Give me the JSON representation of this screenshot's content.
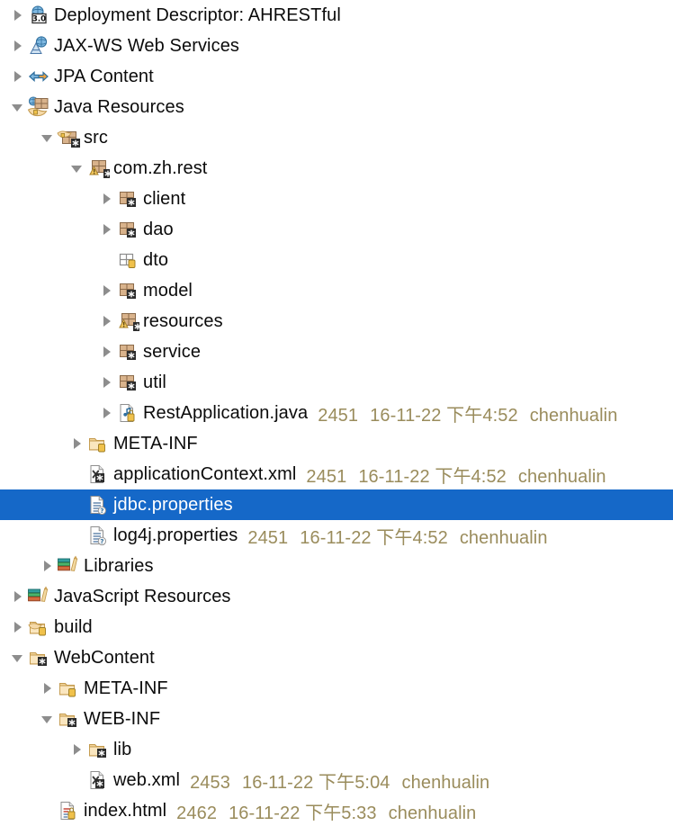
{
  "view": {
    "name": "project-explorer-tree",
    "selection_color": "#1568c8",
    "metadata_color": "#9a8c5c",
    "label_color": "#0b0b0b"
  },
  "rows": [
    {
      "label": "Deployment Descriptor: AHRESTful",
      "icon": "deployment-descriptor-icon",
      "depth": 0,
      "twisty": "collapsed",
      "selected": false,
      "meta": []
    },
    {
      "label": "JAX-WS Web Services",
      "icon": "jaxws-web-services-icon",
      "depth": 0,
      "twisty": "collapsed",
      "selected": false,
      "meta": []
    },
    {
      "label": "JPA Content",
      "icon": "jpa-content-icon",
      "depth": 0,
      "twisty": "collapsed",
      "selected": false,
      "meta": []
    },
    {
      "label": "Java Resources",
      "icon": "java-resources-icon",
      "depth": 0,
      "twisty": "expanded",
      "selected": false,
      "meta": []
    },
    {
      "label": "src",
      "icon": "source-folder-icon",
      "depth": 1,
      "twisty": "expanded",
      "selected": false,
      "meta": []
    },
    {
      "label": "com.zh.rest",
      "icon": "package-warning-icon",
      "depth": 2,
      "twisty": "expanded",
      "selected": false,
      "meta": []
    },
    {
      "label": "client",
      "icon": "package-icon",
      "depth": 3,
      "twisty": "collapsed",
      "selected": false,
      "meta": []
    },
    {
      "label": "dao",
      "icon": "package-icon",
      "depth": 3,
      "twisty": "collapsed",
      "selected": false,
      "meta": []
    },
    {
      "label": "dto",
      "icon": "empty-package-icon",
      "depth": 3,
      "twisty": "none",
      "selected": false,
      "meta": []
    },
    {
      "label": "model",
      "icon": "package-icon",
      "depth": 3,
      "twisty": "collapsed",
      "selected": false,
      "meta": []
    },
    {
      "label": "resources",
      "icon": "package-warning-icon",
      "depth": 3,
      "twisty": "collapsed",
      "selected": false,
      "meta": []
    },
    {
      "label": "service",
      "icon": "package-icon",
      "depth": 3,
      "twisty": "collapsed",
      "selected": false,
      "meta": []
    },
    {
      "label": "util",
      "icon": "package-icon",
      "depth": 3,
      "twisty": "collapsed",
      "selected": false,
      "meta": []
    },
    {
      "label": "RestApplication.java",
      "icon": "java-file-icon",
      "depth": 3,
      "twisty": "collapsed",
      "selected": false,
      "meta": [
        "2451",
        "16-11-22 下午4:52",
        "chenhualin"
      ]
    },
    {
      "label": "META-INF",
      "icon": "folder-icon",
      "depth": 2,
      "twisty": "collapsed",
      "selected": false,
      "meta": []
    },
    {
      "label": "applicationContext.xml",
      "icon": "xml-file-icon",
      "depth": 2,
      "twisty": "none",
      "selected": false,
      "meta": [
        "2451",
        "16-11-22 下午4:52",
        "chenhualin"
      ]
    },
    {
      "label": "jdbc.properties",
      "icon": "properties-file-icon",
      "depth": 2,
      "twisty": "none",
      "selected": true,
      "meta": []
    },
    {
      "label": "log4j.properties",
      "icon": "properties-file-icon",
      "depth": 2,
      "twisty": "none",
      "selected": false,
      "meta": [
        "2451",
        "16-11-22 下午4:52",
        "chenhualin"
      ]
    },
    {
      "label": "Libraries",
      "icon": "libraries-icon",
      "depth": 1,
      "twisty": "collapsed",
      "selected": false,
      "meta": []
    },
    {
      "label": "JavaScript Resources",
      "icon": "libraries-icon",
      "depth": 0,
      "twisty": "collapsed",
      "selected": false,
      "meta": []
    },
    {
      "label": "build",
      "icon": "build-folder-icon",
      "depth": 0,
      "twisty": "collapsed",
      "selected": false,
      "meta": []
    },
    {
      "label": "WebContent",
      "icon": "web-folder-icon",
      "depth": 0,
      "twisty": "expanded",
      "selected": false,
      "meta": []
    },
    {
      "label": "META-INF",
      "icon": "folder-icon",
      "depth": 1,
      "twisty": "collapsed",
      "selected": false,
      "meta": []
    },
    {
      "label": "WEB-INF",
      "icon": "web-folder-icon",
      "depth": 1,
      "twisty": "expanded",
      "selected": false,
      "meta": []
    },
    {
      "label": "lib",
      "icon": "web-folder-icon",
      "depth": 2,
      "twisty": "collapsed",
      "selected": false,
      "meta": []
    },
    {
      "label": "web.xml",
      "icon": "xml-file-icon",
      "depth": 2,
      "twisty": "none",
      "selected": false,
      "meta": [
        "2453",
        "16-11-22 下午5:04",
        "chenhualin"
      ]
    },
    {
      "label": "index.html",
      "icon": "html-file-icon",
      "depth": 1,
      "twisty": "none",
      "selected": false,
      "meta": [
        "2462",
        "16-11-22 下午5:33",
        "chenhualin"
      ]
    }
  ]
}
